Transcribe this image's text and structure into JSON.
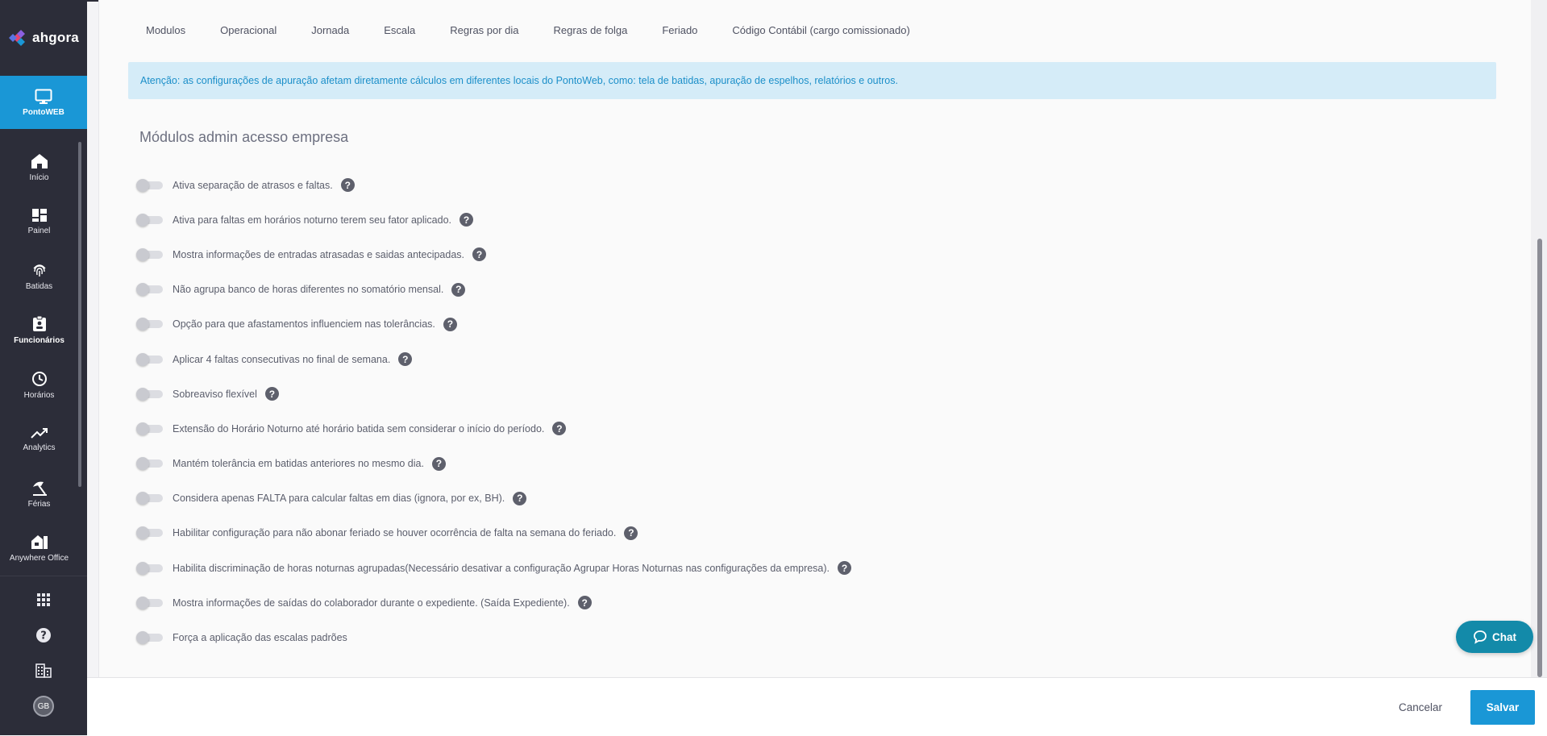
{
  "brand": {
    "name": "ahgora",
    "logo_icon": "ahgora-diamond-logo"
  },
  "sidebar": {
    "active": {
      "label": "PontoWEB",
      "icon": "monitor-icon"
    },
    "items": [
      {
        "label": "Início",
        "icon": "home-icon"
      },
      {
        "label": "Painel",
        "icon": "dashboard-icon"
      },
      {
        "label": "Batidas",
        "icon": "fingerprint-icon"
      },
      {
        "label": "Funcionários",
        "icon": "badge-icon"
      },
      {
        "label": "Horários",
        "icon": "clock-icon"
      },
      {
        "label": "Analytics",
        "icon": "trending-up-icon"
      },
      {
        "label": "Férias",
        "icon": "beach-umbrella-icon"
      },
      {
        "label": "Anywhere Office",
        "icon": "home-office-icon"
      }
    ],
    "bottom": {
      "avatar_initials": "GB"
    }
  },
  "tabs": [
    "Modulos",
    "Operacional",
    "Jornada",
    "Escala",
    "Regras por dia",
    "Regras de folga",
    "Feriado",
    "Código Contábil (cargo comissionado)"
  ],
  "alert": "Atenção: as configurações de apuração afetam diretamente cálculos em diferentes locais do PontoWeb, como: tela de batidas, apuração de espelhos, relatórios e outros.",
  "section": {
    "title": "Módulos admin acesso empresa"
  },
  "options": [
    {
      "label": "Ativa separação de atrasos e faltas.",
      "enabled": false,
      "help": true
    },
    {
      "label": "Ativa para faltas em horários noturno terem seu fator aplicado.",
      "enabled": false,
      "help": true
    },
    {
      "label": "Mostra informações de entradas atrasadas e saidas antecipadas.",
      "enabled": false,
      "help": true
    },
    {
      "label": "Não agrupa banco de horas diferentes no somatório mensal.",
      "enabled": false,
      "help": true
    },
    {
      "label": "Opção para que afastamentos influenciem nas tolerâncias.",
      "enabled": false,
      "help": true
    },
    {
      "label": "Aplicar 4 faltas consecutivas no final de semana.",
      "enabled": false,
      "help": true
    },
    {
      "label": "Sobreaviso flexível",
      "enabled": false,
      "help": true
    },
    {
      "label": "Extensão do Horário Noturno até horário batida sem considerar o início do período.",
      "enabled": false,
      "help": true
    },
    {
      "label": "Mantém tolerância em batidas anteriores no mesmo dia.",
      "enabled": false,
      "help": true
    },
    {
      "label": "Considera apenas FALTA para calcular faltas em dias (ignora, por ex, BH).",
      "enabled": false,
      "help": true
    },
    {
      "label": "Habilitar configuração para não abonar feriado se houver ocorrência de falta na semana do feriado.",
      "enabled": false,
      "help": true
    },
    {
      "label": "Habilita discriminação de horas noturnas agrupadas(Necessário desativar a configuração Agrupar Horas Noturnas nas configurações da empresa).",
      "enabled": false,
      "help": true
    },
    {
      "label": "Mostra informações de saídas do colaborador durante o expediente. (Saída Expediente).",
      "enabled": false,
      "help": true
    },
    {
      "label": "Força a aplicação das escalas padrões",
      "enabled": false,
      "help": false
    }
  ],
  "help_glyph": "?",
  "footer": {
    "cancel": "Cancelar",
    "save": "Salvar"
  },
  "chat": {
    "label": "Chat",
    "icon": "chat-bubble-icon"
  },
  "colors": {
    "primary": "#1a97d6",
    "sidebar": "#2c2d39",
    "alert_bg": "#d5ecf8",
    "chat": "#138aa9"
  }
}
